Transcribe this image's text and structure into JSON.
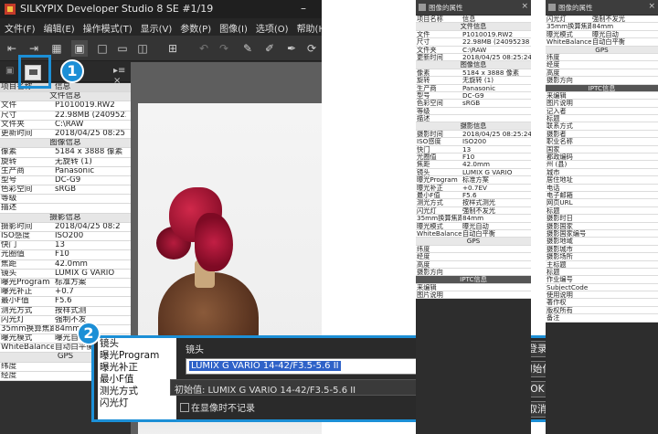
{
  "app": {
    "title": "SILKYPIX Developer Studio 8 SE  #1/19",
    "minimize": "–"
  },
  "menu": [
    "文件(F)",
    "编辑(E)",
    "操作模式(T)",
    "显示(V)",
    "参数(P)",
    "图像(I)",
    "选项(O)",
    "帮助(H)"
  ],
  "toolbar_icons": [
    "import-icon",
    "export-icon",
    "grid-view-icon",
    "single-view-icon",
    "compare-view-icon",
    "list-view-icon",
    "dual-view-icon",
    "undo-icon",
    "redo-icon",
    "eyedropper-icon",
    "develop-icon",
    "wb-icon",
    "rotate-icon",
    "crop-icon",
    "help-icon"
  ],
  "panel": {
    "close": "▸≡ ×",
    "header": {
      "key": "项目名称",
      "value": "信息"
    },
    "rows": [
      {
        "sec": "文件信息"
      },
      {
        "k": "文件",
        "v": "P1010019.RW2"
      },
      {
        "k": "尺寸",
        "v": "22.98MB (24095238"
      },
      {
        "k": "文件夹",
        "v": "C:\\RAW"
      },
      {
        "k": "更新时间",
        "v": "2018/04/25 08:25:2"
      },
      {
        "sec": "图像信息"
      },
      {
        "k": "像素",
        "v": "5184 x 3888 像素"
      },
      {
        "k": "旋转",
        "v": "无旋转 (1)"
      },
      {
        "k": "生产商",
        "v": "Panasonic"
      },
      {
        "k": "型号",
        "v": "DC-G9"
      },
      {
        "k": "色彩空间",
        "v": "sRGB"
      },
      {
        "k": "等级",
        "v": ""
      },
      {
        "k": "描述",
        "v": ""
      },
      {
        "sec": "摄影信息"
      },
      {
        "k": "摄影时间",
        "v": "2018/04/25 08:2"
      },
      {
        "k": "ISO感度",
        "v": "ISO200"
      },
      {
        "k": "快门",
        "v": "13"
      },
      {
        "k": "光圈值",
        "v": "F10"
      },
      {
        "k": "焦距",
        "v": "42.0mm"
      },
      {
        "k": "镜头",
        "v": "LUMIX G VARIO"
      },
      {
        "k": "曝光Program",
        "v": "标准方案"
      },
      {
        "k": "曝光补正",
        "v": "+0.7"
      },
      {
        "k": "最小F值",
        "v": "F5.6"
      },
      {
        "k": "测光方式",
        "v": "按样式测"
      },
      {
        "k": "闪光灯",
        "v": "强制不发"
      },
      {
        "k": "35mm换算焦距",
        "v": "84mm"
      },
      {
        "k": "曝光模式",
        "v": "曝光自动"
      },
      {
        "k": "WhiteBalance",
        "v": "自动白平衡"
      },
      {
        "sec": "GPS"
      },
      {
        "k": "纬度",
        "v": ""
      },
      {
        "k": "经度",
        "v": ""
      }
    ]
  },
  "badges": {
    "one": "1",
    "two": "2"
  },
  "dialog": {
    "list": [
      "镜头",
      "曝光Program",
      "曝光补正",
      "最小F值",
      "测光方式",
      "闪光灯"
    ],
    "label": "镜头",
    "input_value": "LUMIX G VARIO 14-42/F3.5-5.6 II",
    "select_value": "初始值: LUMIX G VARIO 14-42/F3.5-5.6 II",
    "select_arrow": "⌄",
    "checkbox_label": "在显像时不记录",
    "buttons": {
      "register": "登录",
      "init": "初始化",
      "ok": "OK",
      "cancel": "取消"
    }
  },
  "win_a": {
    "title": "图像的属性",
    "close": "×",
    "header": {
      "key": "项目名称",
      "value": "信息"
    },
    "rows": [
      {
        "sec": "文件信息"
      },
      {
        "k": "文件",
        "v": "P1010019.RW2"
      },
      {
        "k": "尺寸",
        "v": "22.98MB (24095238"
      },
      {
        "k": "文件夹",
        "v": "C:\\RAW"
      },
      {
        "k": "更新时间",
        "v": "2018/04/25 08:25:24"
      },
      {
        "sec": "图像信息"
      },
      {
        "k": "像素",
        "v": "5184 x 3888 像素"
      },
      {
        "k": "旋转",
        "v": "无旋转 (1)"
      },
      {
        "k": "生产商",
        "v": "Panasonic"
      },
      {
        "k": "型号",
        "v": "DC-G9"
      },
      {
        "k": "色彩空间",
        "v": "sRGB"
      },
      {
        "k": "等级",
        "v": ""
      },
      {
        "k": "描述",
        "v": ""
      },
      {
        "sec": "摄影信息"
      },
      {
        "k": "摄影时间",
        "v": "2018/04/25 08:25:24"
      },
      {
        "k": "ISO感度",
        "v": "ISO200"
      },
      {
        "k": "快门",
        "v": "13"
      },
      {
        "k": "光圈值",
        "v": "F10"
      },
      {
        "k": "焦距",
        "v": "42.0mm"
      },
      {
        "k": "镜头",
        "v": "LUMIX G VARIO"
      },
      {
        "k": "曝光Program",
        "v": "标准方案"
      },
      {
        "k": "曝光补正",
        "v": "+0.7EV"
      },
      {
        "k": "最小F值",
        "v": "F5.6"
      },
      {
        "k": "测光方式",
        "v": "按样式测光"
      },
      {
        "k": "闪光灯",
        "v": "强制不发光"
      },
      {
        "k": "35mm换算焦距",
        "v": "84mm"
      },
      {
        "k": "曝光模式",
        "v": "曝光自动"
      },
      {
        "k": "WhiteBalance",
        "v": "自动白平衡"
      },
      {
        "sec": "GPS"
      },
      {
        "k": "纬度",
        "v": ""
      },
      {
        "k": "经度",
        "v": ""
      },
      {
        "k": "高度",
        "v": ""
      },
      {
        "k": "摄影方向",
        "v": ""
      },
      {
        "dark": "IPTC信息"
      },
      {
        "k": "来编辑",
        "v": ""
      },
      {
        "k": "图片说明",
        "v": ""
      }
    ]
  },
  "win_b": {
    "title": "图像的属性",
    "close": "×",
    "rows": [
      {
        "k": "闪光灯",
        "v": "强制不发光"
      },
      {
        "k": "35mm换算焦距",
        "v": "84mm"
      },
      {
        "k": "曝光模式",
        "v": "曝光自动"
      },
      {
        "k": "WhiteBalance",
        "v": "自动白平衡"
      },
      {
        "sec": "GPS"
      },
      {
        "k": "纬度",
        "v": ""
      },
      {
        "k": "经度",
        "v": ""
      },
      {
        "k": "高度",
        "v": ""
      },
      {
        "k": "摄影方向",
        "v": ""
      },
      {
        "dark": "IPTC信息"
      },
      {
        "k": "来编辑",
        "v": ""
      },
      {
        "k": "图片说明",
        "v": ""
      },
      {
        "k": "记入者",
        "v": ""
      },
      {
        "k": "标题",
        "v": ""
      },
      {
        "k": "联系方式",
        "v": ""
      },
      {
        "k": "摄影者",
        "v": ""
      },
      {
        "k": "职业名称",
        "v": ""
      },
      {
        "k": "国家",
        "v": ""
      },
      {
        "k": "都政编码",
        "v": ""
      },
      {
        "k": "州 (县)",
        "v": ""
      },
      {
        "k": "城市",
        "v": ""
      },
      {
        "k": "居住地址",
        "v": ""
      },
      {
        "k": "电话",
        "v": ""
      },
      {
        "k": "电子邮箱",
        "v": ""
      },
      {
        "k": "网页URL",
        "v": ""
      },
      {
        "k": "标题",
        "v": ""
      },
      {
        "k": "摄影时日",
        "v": ""
      },
      {
        "k": "摄影国家",
        "v": ""
      },
      {
        "k": "摄影国家编号",
        "v": ""
      },
      {
        "k": "摄影地域",
        "v": ""
      },
      {
        "k": "摄影城市",
        "v": ""
      },
      {
        "k": "摄影场所",
        "v": ""
      },
      {
        "k": "主标题",
        "v": ""
      },
      {
        "k": "标题",
        "v": ""
      },
      {
        "k": "作业编号",
        "v": ""
      },
      {
        "k": "SubjectCode",
        "v": ""
      },
      {
        "k": "使用说明",
        "v": ""
      },
      {
        "k": "著作权",
        "v": ""
      },
      {
        "k": "版权所有",
        "v": ""
      },
      {
        "k": "备注",
        "v": ""
      }
    ]
  }
}
